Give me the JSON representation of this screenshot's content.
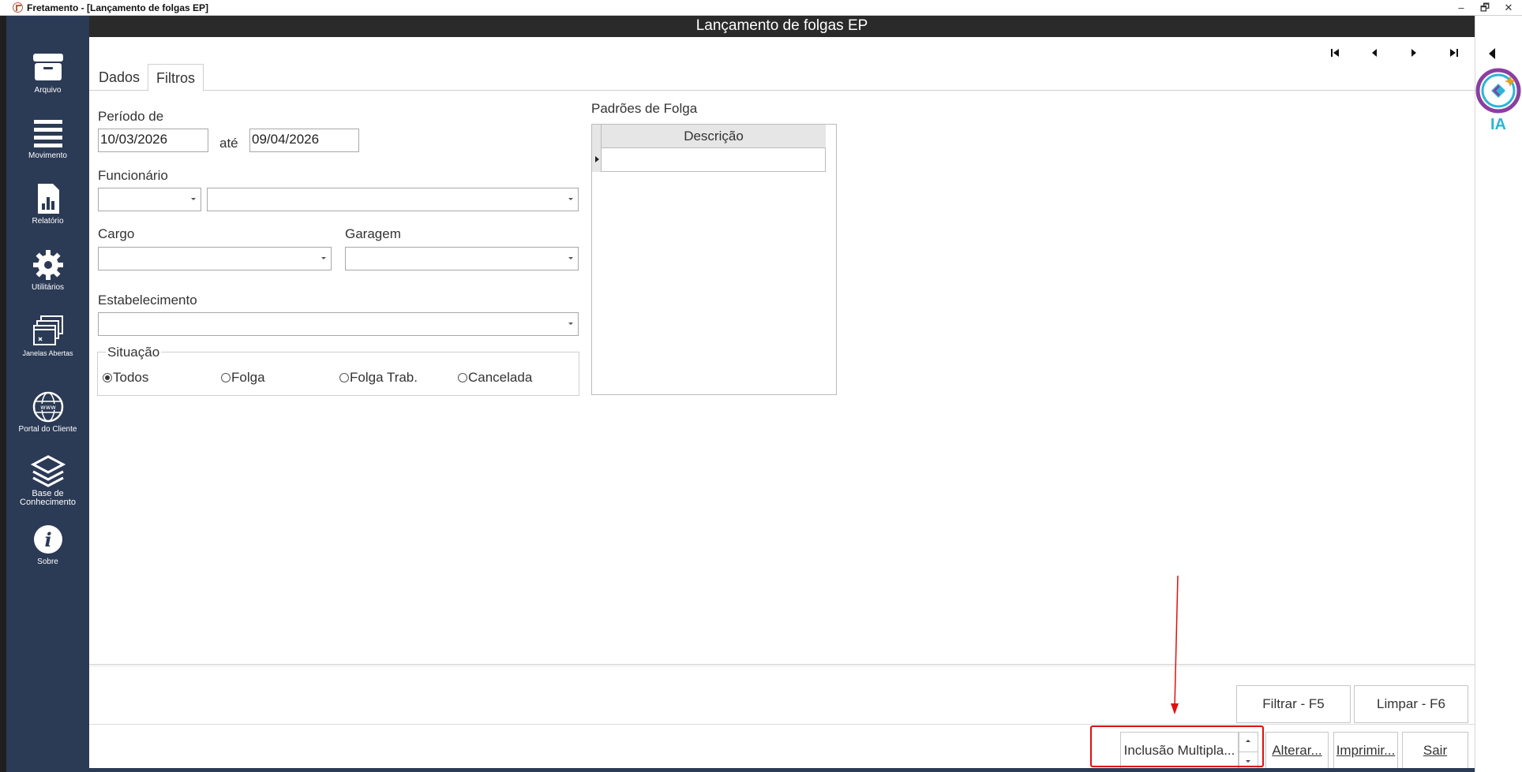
{
  "titlebar": {
    "title": "Fretamento - [Lançamento de folgas EP]",
    "min": "–",
    "max": "🗗",
    "close": "✕"
  },
  "window_title": "Lançamento de folgas EP",
  "sidebar": {
    "items": [
      {
        "label": "Arquivo",
        "icon": "archive-icon"
      },
      {
        "label": "Movimento",
        "icon": "menu-lines-icon"
      },
      {
        "label": "Relatório",
        "icon": "report-chart-icon"
      },
      {
        "label": "Utilitários",
        "icon": "gear-icon"
      },
      {
        "label": "Janelas Abertas",
        "icon": "windows-icon"
      },
      {
        "label": "Portal do Cliente",
        "icon": "globe-www-icon"
      },
      {
        "label": "Base de Conhecimento",
        "icon": "layers-icon"
      },
      {
        "label": "Sobre",
        "icon": "info-icon"
      }
    ]
  },
  "tabs": [
    {
      "label": "Dados",
      "active": false
    },
    {
      "label": "Filtros",
      "active": true
    }
  ],
  "filters": {
    "periodo_label": "Período de",
    "date_from": "10/03/2026",
    "ate_label": "até",
    "date_to": "09/04/2026",
    "funcionario_label": "Funcionário",
    "funcionario_code": "",
    "funcionario_name": "",
    "cargo_label": "Cargo",
    "cargo_value": "",
    "garagem_label": "Garagem",
    "garagem_value": "",
    "estabelecimento_label": "Estabelecimento",
    "estabelecimento_value": "",
    "situacao": {
      "title": "Situação",
      "options": [
        "Todos",
        "Folga",
        "Folga Trab.",
        "Cancelada"
      ],
      "selected": "Todos"
    }
  },
  "padroes": {
    "title": "Padrões de Folga",
    "column": "Descrição",
    "rows": [
      ""
    ]
  },
  "buttons": {
    "filtrar": "Filtrar - F5",
    "limpar": "Limpar - F6",
    "inclusao": "Inclusão Multipla...",
    "alterar": "Alterar...",
    "imprimir": "Imprimir...",
    "sair": "Sair"
  },
  "ia": {
    "label": "IA"
  },
  "colors": {
    "sidebar": "#2b3a55",
    "highlight": "#e01010",
    "ia": "#2bb5d8"
  }
}
